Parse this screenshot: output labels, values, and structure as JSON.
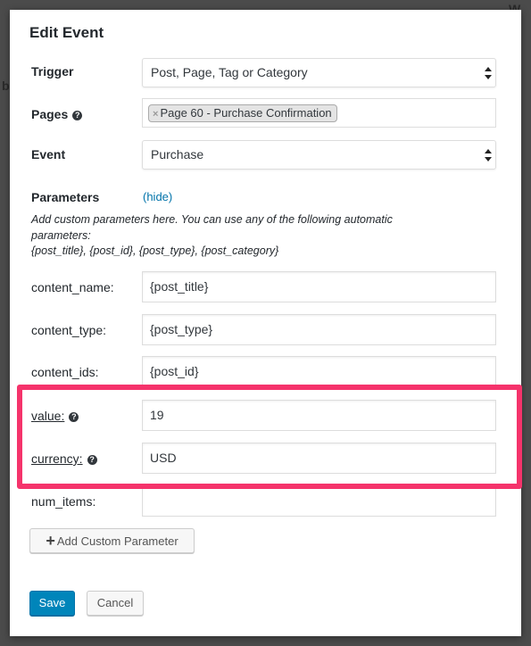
{
  "background": {
    "text_1": "W",
    "text_2": "b"
  },
  "modal": {
    "title": "Edit Event"
  },
  "trigger": {
    "label": "Trigger",
    "value": "Post, Page, Tag or Category"
  },
  "pages": {
    "label": "Pages",
    "help_icon": "question-circle-icon",
    "tags": [
      "Page 60 - Purchase Confirmation"
    ],
    "remove_glyph": "×"
  },
  "event": {
    "label": "Event",
    "value": "Purchase"
  },
  "parameters": {
    "label": "Parameters",
    "toggle_link": "(hide)",
    "description_line1": "Add custom parameters here. You can use any of the following automatic",
    "description_line2": "parameters:",
    "description_line3": "{post_title}, {post_id}, {post_type}, {post_category}",
    "fields": [
      {
        "label": "content_name:",
        "value": "{post_title}"
      },
      {
        "label": "content_type:",
        "value": "{post_type}"
      },
      {
        "label": "content_ids:",
        "value": "{post_id}"
      },
      {
        "label": "value:",
        "value": "19"
      },
      {
        "label": "currency:",
        "value": "USD"
      },
      {
        "label": "num_items:",
        "value": ""
      }
    ]
  },
  "buttons": {
    "add_parameter": "Add Custom Parameter",
    "save": "Save",
    "cancel": "Cancel"
  },
  "colors": {
    "highlight": "#f5336b",
    "primary": "#0085ba",
    "link": "#0073aa"
  }
}
